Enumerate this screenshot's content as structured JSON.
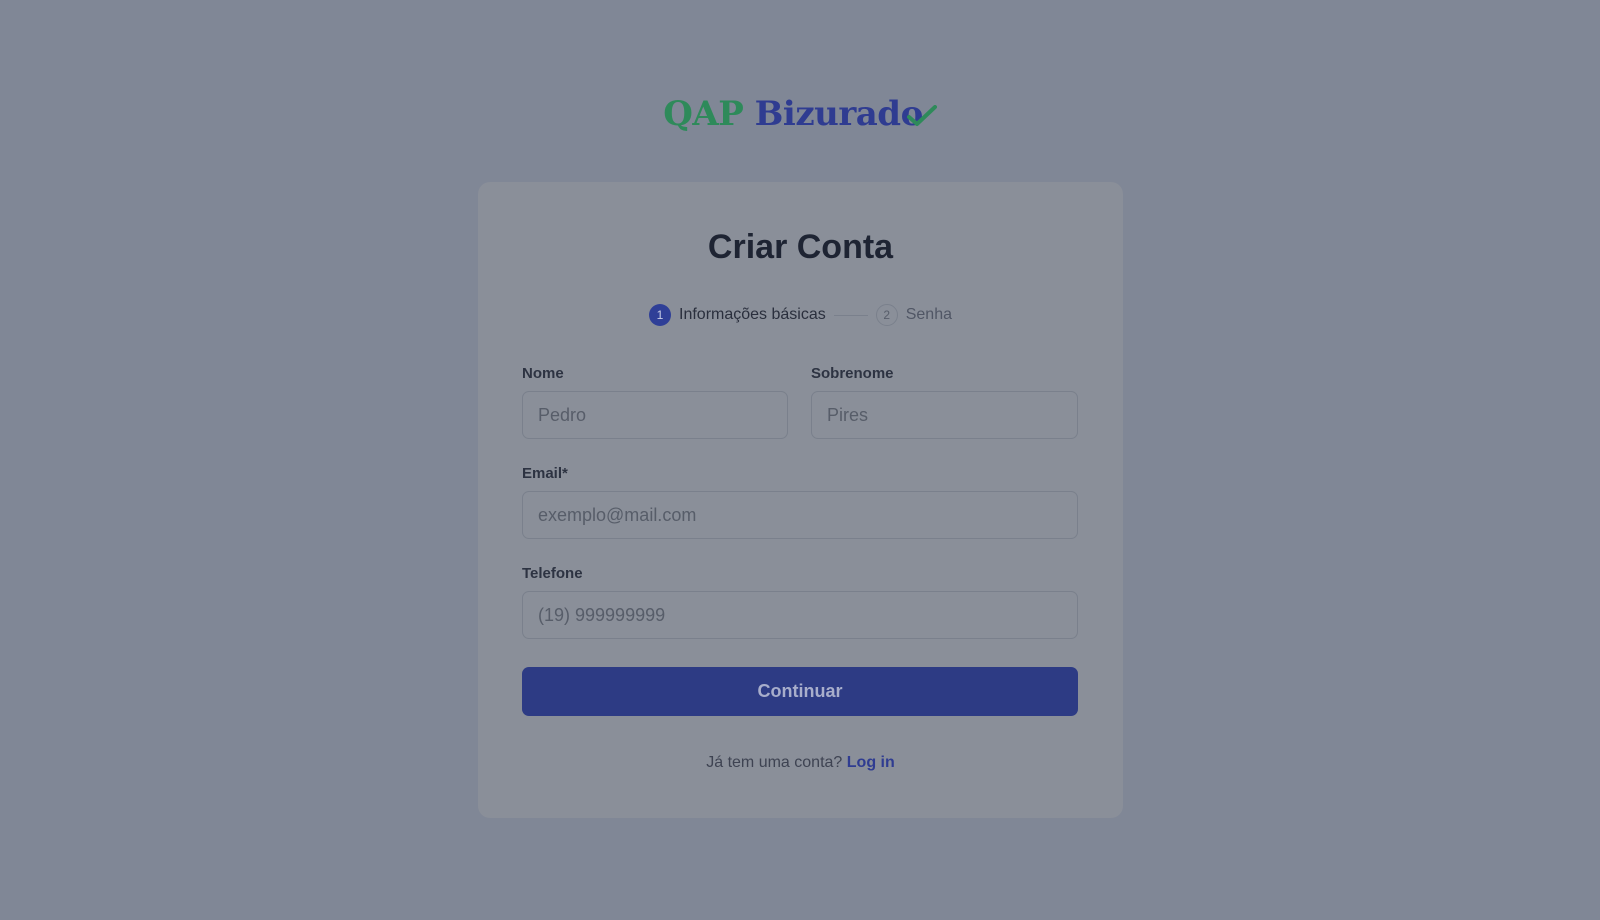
{
  "logo": {
    "part1": "QAP",
    "part2": "Bizurado",
    "color_part1": "#2e8a5a",
    "color_part2": "#2f3c91",
    "check_icon": "checkmark-icon"
  },
  "form": {
    "title": "Criar Conta",
    "steps": [
      {
        "number": "1",
        "label": "Informações básicas",
        "state": "active"
      },
      {
        "number": "2",
        "label": "Senha",
        "state": "inactive"
      }
    ],
    "fields": {
      "first_name": {
        "label": "Nome",
        "placeholder": "Pedro",
        "value": ""
      },
      "last_name": {
        "label": "Sobrenome",
        "placeholder": "Pires",
        "value": ""
      },
      "email": {
        "label": "Email*",
        "placeholder": "exemplo@mail.com",
        "value": ""
      },
      "phone": {
        "label": "Telefone",
        "placeholder": "(19) 999999999",
        "value": ""
      }
    },
    "submit_label": "Continuar",
    "footer": {
      "prompt": "Já tem uma conta?",
      "link_label": "Log in"
    }
  },
  "colors": {
    "overlay_background": "#808796",
    "card_background": "#8a8f99",
    "primary": "#2d3b84",
    "step_active": "#2f3f97"
  }
}
